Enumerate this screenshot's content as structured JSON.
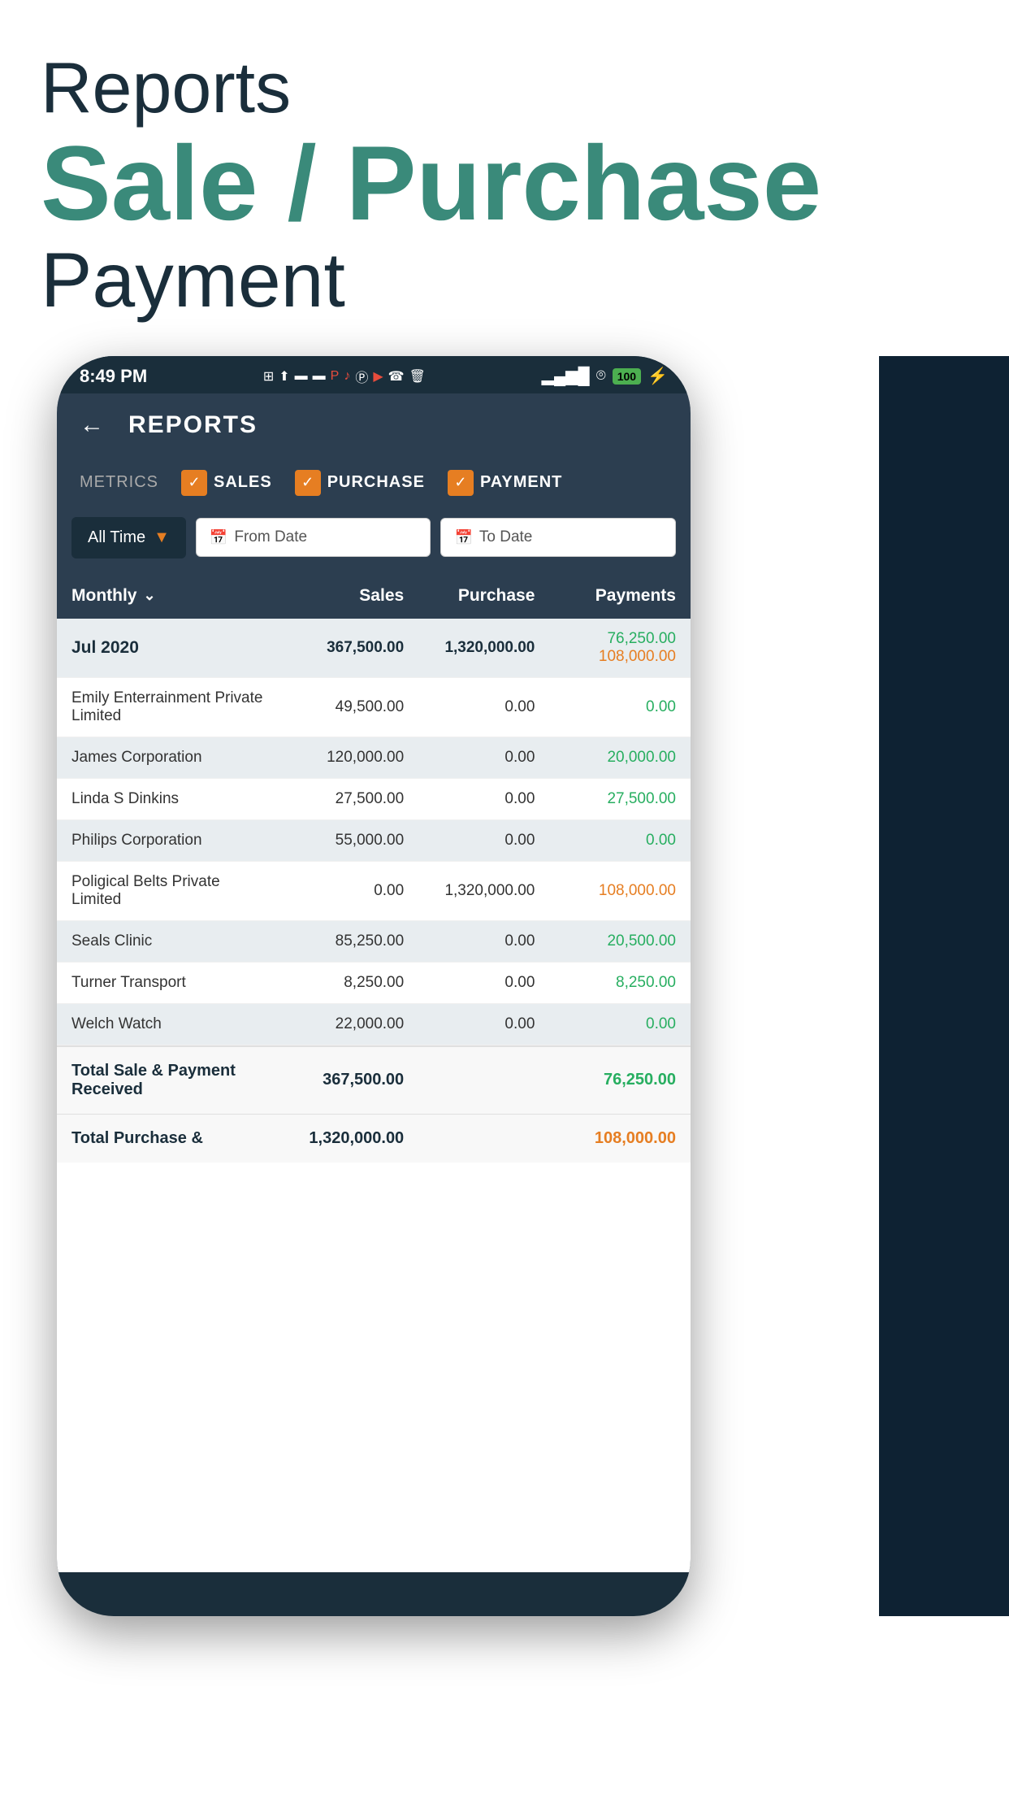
{
  "hero": {
    "reports_label": "Reports",
    "sale_purchase_label": "Sale / Purchase",
    "payment_label": "Payment"
  },
  "status_bar": {
    "time": "8:49 PM",
    "battery": "100"
  },
  "app": {
    "title": "REPORTS",
    "back_label": "←"
  },
  "metrics": {
    "label": "METRICS",
    "items": [
      {
        "id": "sales",
        "label": "SALES",
        "checked": true
      },
      {
        "id": "purchase",
        "label": "PURCHASE",
        "checked": true
      },
      {
        "id": "payment",
        "label": "PAYMENT",
        "checked": true
      }
    ]
  },
  "filters": {
    "all_time_label": "All Time",
    "from_date_label": "From Date",
    "to_date_label": "To Date"
  },
  "table": {
    "headers": {
      "monthly": "Monthly",
      "sales": "Sales",
      "purchase": "Purchase",
      "payments": "Payments"
    },
    "rows": [
      {
        "id": "jul2020",
        "period": "Jul 2020",
        "sales": "367,500.00",
        "purchase": "1,320,000.00",
        "payments_green": "76,250.00",
        "payments_orange": "108,000.00",
        "highlight": true
      },
      {
        "id": "emily",
        "name": "Emily Enterrainment Private Limited",
        "sales": "49,500.00",
        "purchase": "0.00",
        "payment": "0.00",
        "payment_color": "green",
        "highlight": false
      },
      {
        "id": "james",
        "name": "James Corporation",
        "sales": "120,000.00",
        "purchase": "0.00",
        "payment": "20,000.00",
        "payment_color": "green",
        "highlight": false
      },
      {
        "id": "linda",
        "name": "Linda S Dinkins",
        "sales": "27,500.00",
        "purchase": "0.00",
        "payment": "27,500.00",
        "payment_color": "green",
        "highlight": false
      },
      {
        "id": "philips",
        "name": "Philips Corporation",
        "sales": "55,000.00",
        "purchase": "0.00",
        "payment": "0.00",
        "payment_color": "green",
        "highlight": false
      },
      {
        "id": "poligical",
        "name": "Poligical Belts Private Limited",
        "sales": "0.00",
        "purchase": "1,320,000.00",
        "payment": "108,000.00",
        "payment_color": "orange",
        "highlight": false
      },
      {
        "id": "seals",
        "name": "Seals Clinic",
        "sales": "85,250.00",
        "purchase": "0.00",
        "payment": "20,500.00",
        "payment_color": "green",
        "highlight": false
      },
      {
        "id": "turner",
        "name": "Turner Transport",
        "sales": "8,250.00",
        "purchase": "0.00",
        "payment": "8,250.00",
        "payment_color": "green",
        "highlight": false
      },
      {
        "id": "welch",
        "name": "Welch Watch",
        "sales": "22,000.00",
        "purchase": "0.00",
        "payment": "0.00",
        "payment_color": "green",
        "highlight": false
      }
    ],
    "totals": [
      {
        "label": "Total Sale & Payment Received",
        "sales": "367,500.00",
        "purchase": "",
        "payment": "76,250.00",
        "payment_color": "green"
      },
      {
        "label": "Total Purchase &",
        "sales": "1,320,000.00",
        "purchase": "",
        "payment": "108,000.00",
        "payment_color": "orange"
      }
    ]
  }
}
